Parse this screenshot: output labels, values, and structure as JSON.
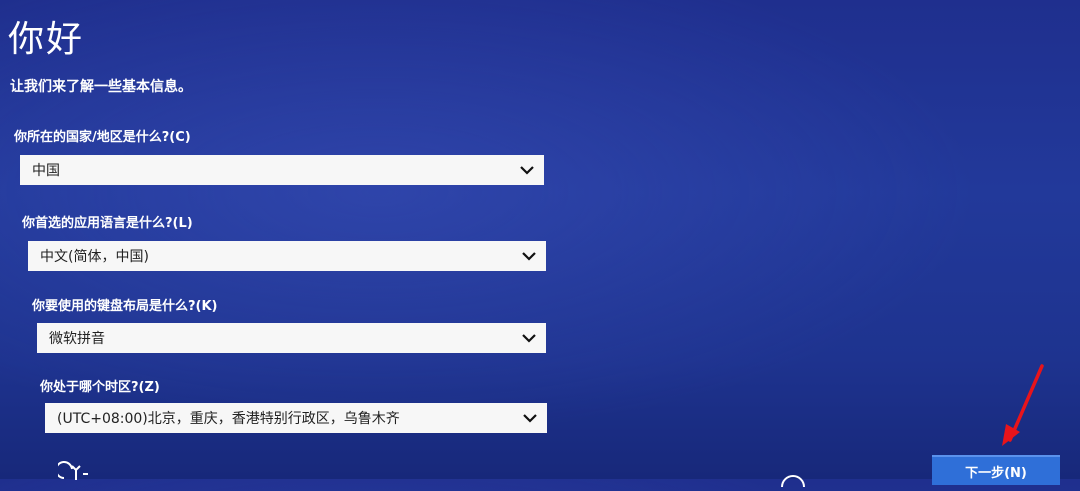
{
  "header": {
    "title": "你好",
    "subtitle": "让我们来了解一些基本信息。"
  },
  "fields": [
    {
      "label": "你所在的国家/地区是什么?(C)",
      "value": "中国"
    },
    {
      "label": "你首选的应用语言是什么?(L)",
      "value": "中文(简体，中国)"
    },
    {
      "label": "你要使用的键盘布局是什么?(K)",
      "value": "微软拼音"
    },
    {
      "label": "你处于哪个时区?(Z)",
      "value": "(UTC+08:00)北京，重庆，香港特别行政区，乌鲁木齐"
    }
  ],
  "footer": {
    "next_label": "下一步(N)",
    "accessibility_icon": "accessibility-icon",
    "annotation_arrow_color": "#e8141b"
  },
  "colors": {
    "background": "#22399a",
    "dropdown_bg": "#f7f7f7",
    "button_bg": "#2f6fd8"
  }
}
